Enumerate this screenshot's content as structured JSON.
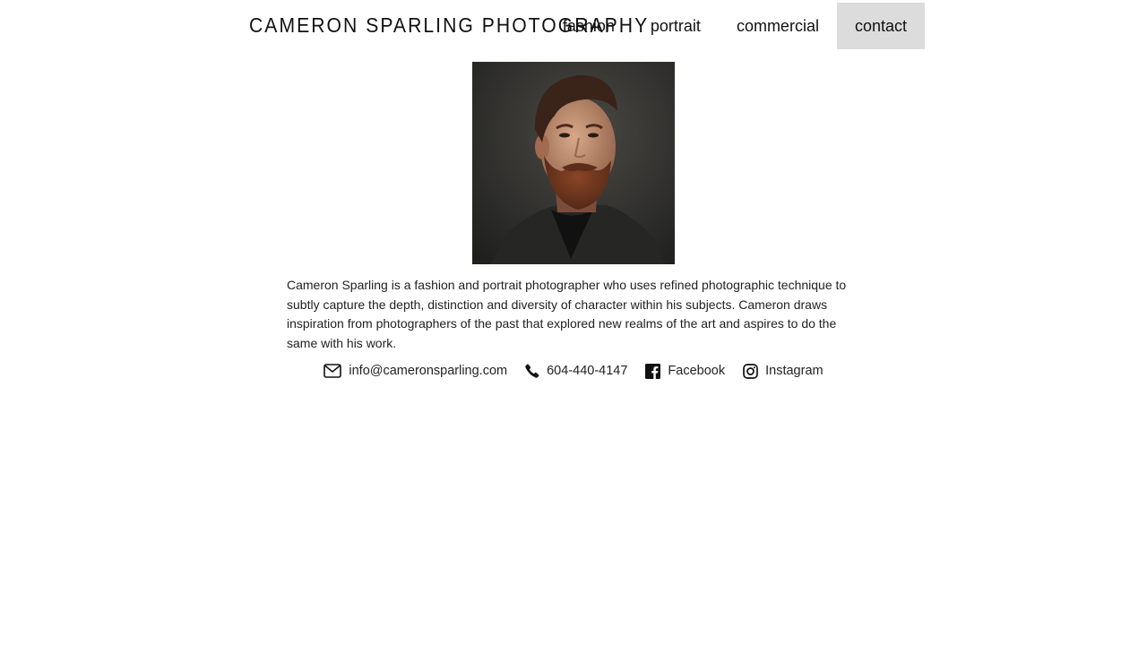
{
  "header": {
    "site_title": "CAMERON SPARLING PHOTOGRAPHY",
    "nav": [
      {
        "label": "fashion",
        "name": "nav-fashion"
      },
      {
        "label": "portrait",
        "name": "nav-portrait"
      },
      {
        "label": "commercial",
        "name": "nav-commercial"
      },
      {
        "label": "contact",
        "name": "nav-contact",
        "active": true
      }
    ]
  },
  "main": {
    "bio": "Cameron Sparling is a fashion and portrait photographer who uses refined photographic technique to subtly capture the depth, distinction and diversity of character within his subjects. Cameron draws inspiration from photographers of the past that explored new realms of the art and aspires to do the same with his work.",
    "contacts": {
      "email": {
        "label": "info@cameronsparling.com",
        "icon": "envelope-icon"
      },
      "phone": {
        "label": "604-440-4147",
        "icon": "phone-icon"
      },
      "facebook": {
        "label": "Facebook",
        "icon": "facebook-icon"
      },
      "instagram": {
        "label": "Instagram",
        "icon": "instagram-icon"
      }
    }
  },
  "colors": {
    "active_nav_bg": "#dcdcdc",
    "text": "#111111"
  }
}
